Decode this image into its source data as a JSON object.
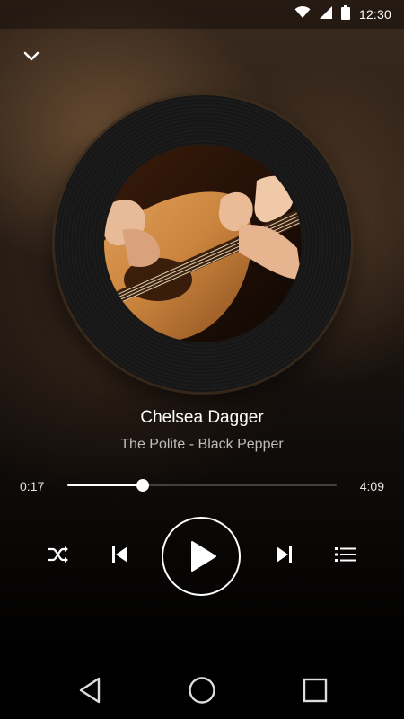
{
  "status_bar": {
    "time": "12:30",
    "icons": [
      "wifi-icon",
      "cell-signal-icon",
      "battery-icon"
    ]
  },
  "header": {
    "collapse_icon": "chevron-down-icon"
  },
  "album_art": {
    "description": "acoustic-guitar-photo"
  },
  "track": {
    "title": "Chelsea Dagger",
    "artist_album": "The Polite - Black Pepper"
  },
  "progress": {
    "elapsed": "0:17",
    "duration": "4:09",
    "fraction": 0.28
  },
  "controls": {
    "shuffle_icon": "shuffle-icon",
    "previous_icon": "skip-previous-icon",
    "play_icon": "play-icon",
    "next_icon": "skip-next-icon",
    "playlist_icon": "playlist-icon"
  },
  "nav_bar": {
    "back_icon": "back-triangle-icon",
    "home_icon": "home-circle-icon",
    "recents_icon": "recents-square-icon"
  },
  "colors": {
    "accent": "#ffffff",
    "background": "#000000",
    "secondary_text": "#bdbdbd"
  }
}
